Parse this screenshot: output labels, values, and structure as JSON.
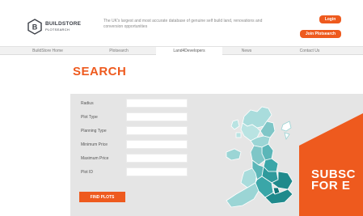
{
  "header": {
    "logo_name": "BUILDSTORE",
    "logo_sub": "PLOTSEARCH",
    "logo_letter": "B",
    "tagline": "The UK's largest and most accurate database of genuine self build land, renovations and conversion opportunities",
    "login_label": "Login",
    "join_label": "Join Plotsearch"
  },
  "nav": {
    "items": [
      {
        "label": "BuildStore Home"
      },
      {
        "label": "Plotsearch"
      },
      {
        "label": "Land4Developers"
      },
      {
        "label": "News"
      },
      {
        "label": "Contact Us"
      }
    ],
    "active_index": 2
  },
  "search": {
    "title": "SEARCH",
    "fields": [
      {
        "label": "Radius",
        "value": ""
      },
      {
        "label": "Plot Type",
        "value": ""
      },
      {
        "label": "Planning Type",
        "value": ""
      },
      {
        "label": "Minimum Price",
        "value": ""
      },
      {
        "label": "Maximum Price",
        "value": ""
      },
      {
        "label": "Plot ID",
        "value": ""
      }
    ],
    "find_label": "FIND PLOTS"
  },
  "subscribe": {
    "line1": "SUBSC",
    "line2": "FOR E"
  },
  "colors": {
    "accent": "#ee5a1e",
    "map_teal": "#3aa6a8",
    "map_light": "#a9dcdc"
  }
}
